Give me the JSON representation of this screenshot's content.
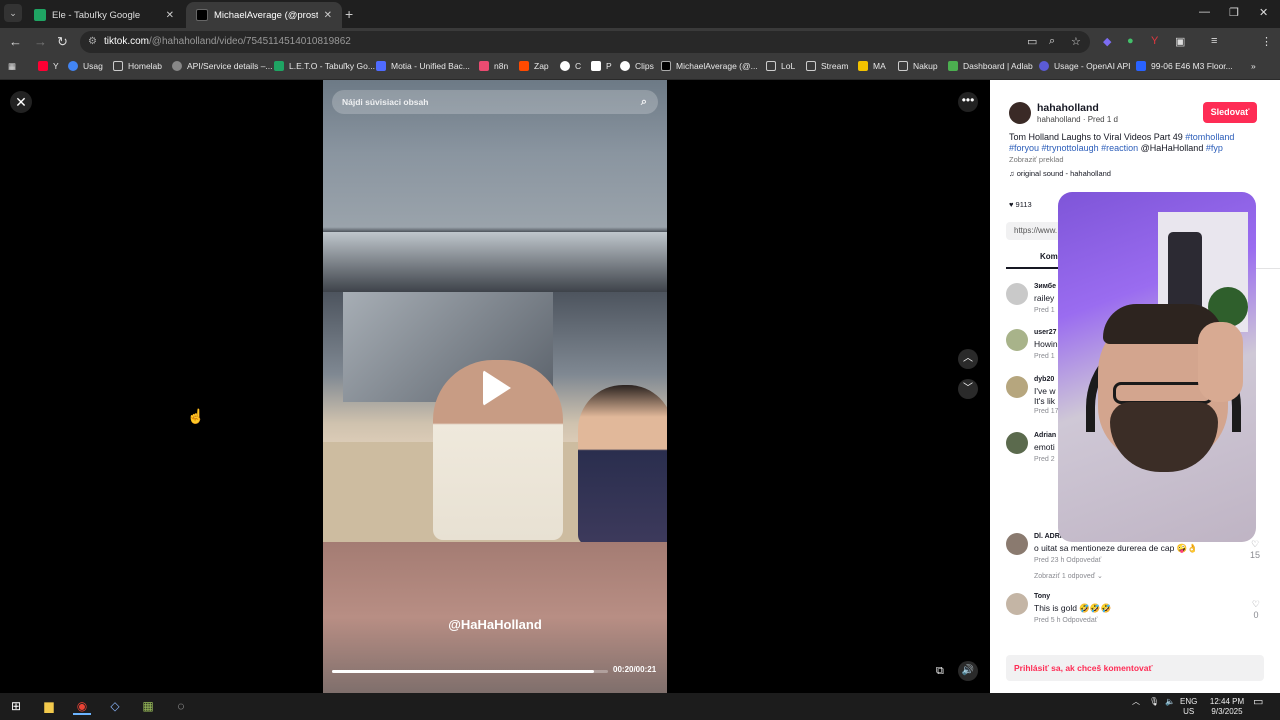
{
  "tabs": [
    {
      "title": "Ele - Tabuľky Google",
      "icon": "sheets-icon",
      "color": "#1fa463"
    },
    {
      "title": "MichaelAverage (@prosteavera...",
      "icon": "tiktok-icon",
      "color": "#ffffff"
    }
  ],
  "address": {
    "host": "tiktok.com",
    "path": "/@hahaholland/video/7545114514010819862"
  },
  "bookmarks": [
    {
      "label": "Y",
      "color": "#ff0033"
    },
    {
      "label": "Usag",
      "color": "#4285f4"
    },
    {
      "label": "Homelab",
      "color": "#d0d0d0"
    },
    {
      "label": "API/Service details –...",
      "color": "#888888"
    },
    {
      "label": "L.E.T.O - Tabuľky Go...",
      "color": "#1fa463"
    },
    {
      "label": "Motia - Unified Bac...",
      "color": "#4f6bff"
    },
    {
      "label": "n8n",
      "color": "#ea4b71"
    },
    {
      "label": "Zap",
      "color": "#ff4a00"
    },
    {
      "label": "C",
      "color": "#ffffff"
    },
    {
      "label": "P",
      "color": "#ffffff"
    },
    {
      "label": "Clips",
      "color": "#ffffff"
    },
    {
      "label": "MichaelAverage (@...",
      "color": "#ffffff"
    },
    {
      "label": "LoL",
      "color": "#d0d0d0"
    },
    {
      "label": "Stream",
      "color": "#d0d0d0"
    },
    {
      "label": "MA",
      "color": "#f2c200"
    },
    {
      "label": "Nakup",
      "color": "#d0d0d0"
    },
    {
      "label": "Dashboard | Adlab",
      "color": "#4caf50"
    },
    {
      "label": "Usage - OpenAI API",
      "color": "#5b5bd6"
    },
    {
      "label": "99-06 E46 M3 Floor...",
      "color": "#2962ff"
    }
  ],
  "video": {
    "search_placeholder": "Nájdi súvisiaci obsah",
    "watermark": "@HaHaHolland",
    "timecode": "00:20/00:21",
    "progress": 0.95
  },
  "post": {
    "username": "hahaholland",
    "sub": "hahaholland · Pred 1 d",
    "follow_label": "Sledovať",
    "desc_text": "Tom Holland Laughs to Viral Videos Part 49",
    "tags": [
      "#tomholland",
      "#foryou",
      "#trynottolaugh",
      "#reaction"
    ],
    "mention": "@HaHaHolland",
    "tag_last": "#fyp",
    "translate": "Zobraziť preklad",
    "sound": "original sound - hahaholland",
    "likes": "9113",
    "link": "https://www.",
    "comments_tab": "Kome"
  },
  "comments": [
    {
      "name": "Зимбе",
      "text": "railey",
      "meta": "Pred 1",
      "like": ""
    },
    {
      "name": "user27",
      "text": "Howin",
      "meta": "Pred 1",
      "like": ""
    },
    {
      "name": "dyb20",
      "text": "I've w",
      "text2": "It's lik",
      "meta": "Pred 17",
      "like": ""
    },
    {
      "name": "Adrian",
      "text": "emoti",
      "meta": "Pred 2",
      "like": ""
    },
    {
      "name": "Dl. ADRIAN",
      "text": "o uitat sa mentioneze durerea de cap 🤪👌",
      "meta": "Pred 23 h    Odpovedať",
      "more": "Zobraziť 1 odpoveď ⌄",
      "like": "15"
    },
    {
      "name": "Tony",
      "text": "This is gold 🤣🤣🤣",
      "meta": "Pred 5 h    Odpovedať",
      "like": "0"
    }
  ],
  "login_prompt": "Prihlásiť sa, ak chceš komentovať",
  "taskbar": {
    "lang1": "ENG",
    "lang2": "US",
    "time": "12:44 PM",
    "date": "9/3/2025"
  }
}
